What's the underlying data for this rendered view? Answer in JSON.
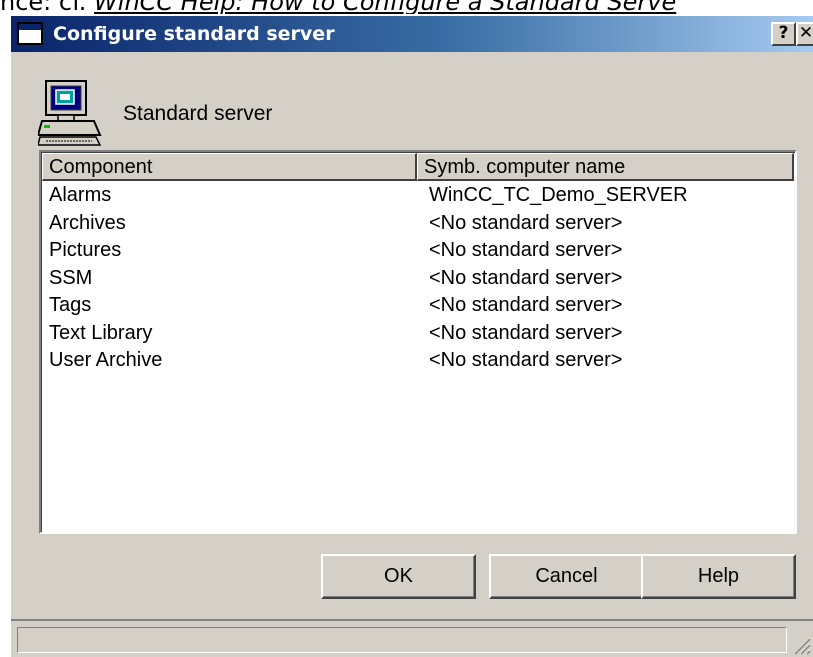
{
  "page_caption": {
    "prefix": "nce: cf. ",
    "link": "WinCC Help: How to Configure a Standard Serve"
  },
  "window": {
    "title": "Configure standard server",
    "help_button": "?",
    "close_button": "✕"
  },
  "header": {
    "icon": "server-computer-icon",
    "label": "Standard server"
  },
  "list": {
    "columns": [
      "Component",
      "Symb. computer name"
    ],
    "rows": [
      {
        "component": "Alarms",
        "server": "WinCC_TC_Demo_SERVER"
      },
      {
        "component": "Archives",
        "server": "<No standard server>"
      },
      {
        "component": "Pictures",
        "server": "<No standard server>"
      },
      {
        "component": "SSM",
        "server": "<No standard server>"
      },
      {
        "component": "Tags",
        "server": "<No standard server>"
      },
      {
        "component": "Text Library",
        "server": "<No standard server>"
      },
      {
        "component": "User Archive",
        "server": "<No standard server>"
      }
    ]
  },
  "buttons": {
    "ok": "OK",
    "cancel": "Cancel",
    "help": "Help"
  },
  "colors": {
    "title_bar_start": "#0a246a",
    "title_bar_end": "#a6caf0",
    "dialog_face": "#d4d0c8"
  }
}
